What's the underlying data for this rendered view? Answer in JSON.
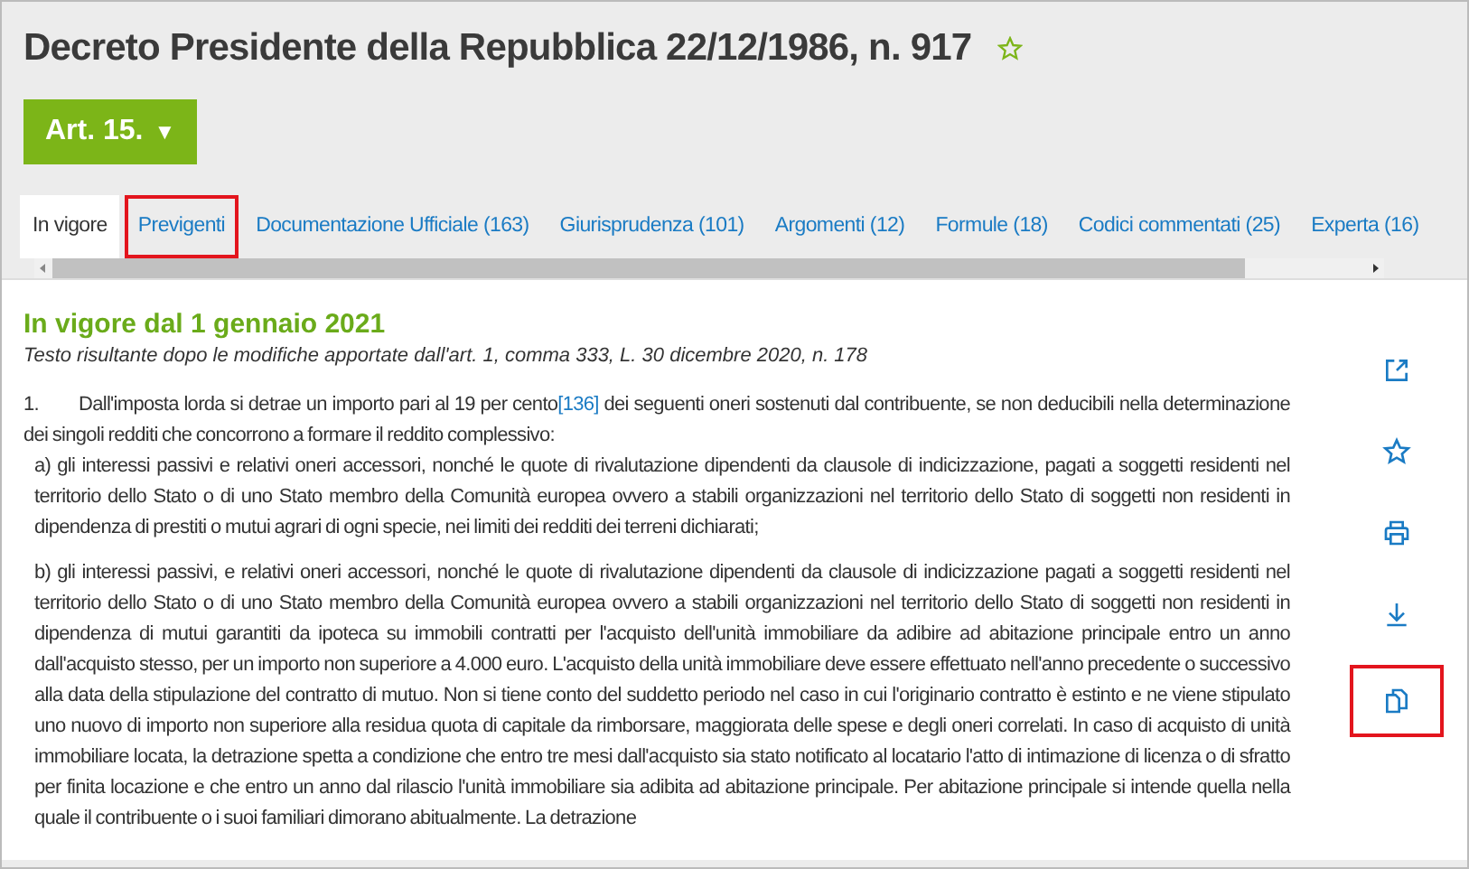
{
  "document": {
    "title": "Decreto Presidente della Repubblica 22/12/1986, n. 917",
    "favorite": false,
    "article_button": "Art. 15.",
    "article_caret": "▼"
  },
  "tabs": [
    {
      "label": "In vigore",
      "selected": true,
      "highlighted": false
    },
    {
      "label": "Previgenti",
      "selected": false,
      "highlighted": true
    },
    {
      "label": "Documentazione Ufficiale (163)",
      "selected": false,
      "highlighted": false
    },
    {
      "label": "Giurisprudenza (101)",
      "selected": false,
      "highlighted": false
    },
    {
      "label": "Argomenti (12)",
      "selected": false,
      "highlighted": false
    },
    {
      "label": "Formule (18)",
      "selected": false,
      "highlighted": false
    },
    {
      "label": "Codici commentati (25)",
      "selected": false,
      "highlighted": false
    },
    {
      "label": "Experta (16)",
      "selected": false,
      "highlighted": false
    }
  ],
  "article": {
    "heading": "In vigore dal 1 gennaio 2021",
    "note": "Testo risultante dopo le modifiche apportate dall'art. 1, comma 333, L. 30 dicembre 2020, n. 178",
    "paragraph": {
      "number": "1.",
      "text": "Dall'imposta lorda si detrae un importo pari al 19 per cento",
      "footnote": "[136]",
      "text_after": " dei seguenti oneri sostenuti dal contribuente, se non deducibili nella determinazione dei singoli redditi che concorrono a formare il reddito complessivo:"
    },
    "items": [
      "a)  gli interessi passivi e relativi oneri accessori, nonché le quote di rivalutazione dipendenti da clausole di indicizzazione, pagati a soggetti residenti nel territorio dello Stato o di uno Stato membro della Comunità europea ovvero a stabili organizzazioni nel territorio dello Stato di soggetti non residenti in dipendenza di prestiti o mutui agrari di ogni specie, nei limiti dei redditi dei terreni dichiarati;",
      "b)  gli interessi passivi, e relativi oneri accessori, nonché le quote di rivalutazione dipendenti da clausole di indicizzazione pagati a soggetti residenti nel territorio dello Stato o di uno Stato membro della Comunità europea ovvero a stabili organizzazioni nel territorio dello Stato di soggetti non residenti in dipendenza di mutui garantiti da ipoteca su immobili contratti per l'acquisto dell'unità immobiliare da adibire ad abitazione principale entro un anno dall'acquisto stesso, per un importo non superiore a 4.000 euro. L'acquisto della unità immobiliare deve essere effettuato nell'anno precedente o successivo alla data della stipulazione del contratto di mutuo. Non si tiene conto del suddetto periodo nel caso in cui l'originario contratto è estinto e ne viene stipulato uno nuovo di importo non superiore alla residua quota di capitale da rimborsare, maggiorata delle spese e degli oneri correlati. In caso di acquisto di unità immobiliare locata, la detrazione spetta a condizione che entro tre mesi dall'acquisto sia stato notificato al locatario l'atto di intimazione di licenza o di sfratto per finita locazione e che entro un anno dal rilascio l'unità immobiliare sia adibita ad abitazione principale. Per abitazione principale si intende quella nella quale il contribuente o i suoi familiari dimorano abitualmente. La detrazione"
    ]
  },
  "tools": [
    {
      "kind": "open",
      "highlighted": false
    },
    {
      "kind": "favorite",
      "highlighted": false
    },
    {
      "kind": "print",
      "highlighted": false
    },
    {
      "kind": "download",
      "highlighted": false
    },
    {
      "kind": "copy",
      "highlighted": true
    }
  ]
}
